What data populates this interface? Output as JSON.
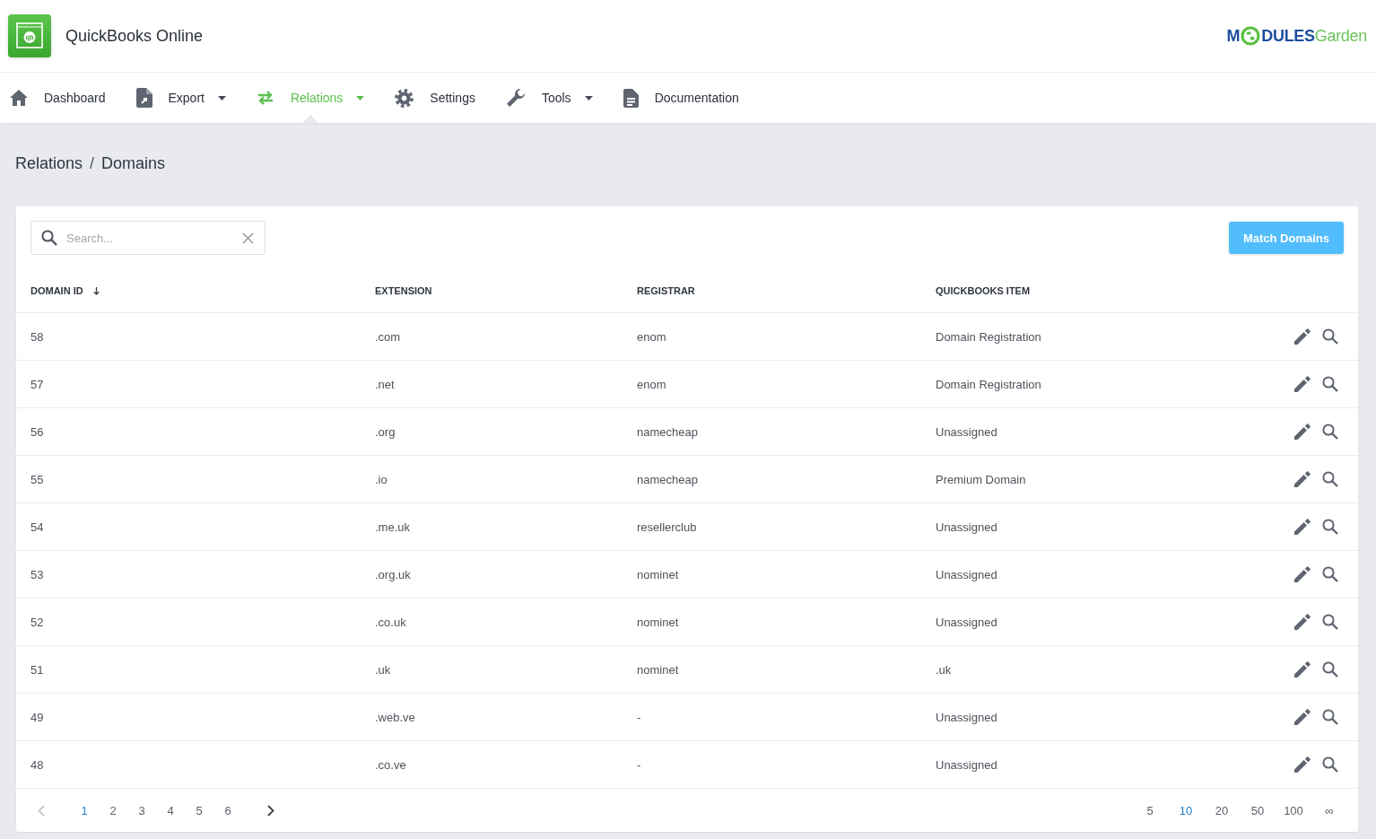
{
  "app": {
    "logo_text": "qb",
    "title": "QuickBooks Online"
  },
  "brand_logo": {
    "lead": "M",
    "rest": "**DULES**Garden"
  },
  "nav": [
    {
      "label": "Dashboard",
      "selected": false,
      "dropdown": false
    },
    {
      "label": "Export",
      "selected": false,
      "dropdown": true
    },
    {
      "label": "Relations",
      "selected": true,
      "dropdown": true
    },
    {
      "label": "Settings",
      "selected": false,
      "dropdown": false
    },
    {
      "label": "Tools",
      "selected": false,
      "dropdown": true
    },
    {
      "label": "Documentation",
      "selected": false,
      "dropdown": false
    }
  ],
  "breadcrumb": {
    "items": [
      "Relations",
      "Domains"
    ],
    "separator": "/"
  },
  "search": {
    "placeholder": "Search..."
  },
  "primary_button": "Match Domains",
  "table": {
    "columns": [
      {
        "label": "DOMAIN ID",
        "sorted": true
      },
      {
        "label": "EXTENSION",
        "sorted": false
      },
      {
        "label": "REGISTRAR",
        "sorted": false
      },
      {
        "label": "QUICKBOOKS ITEM",
        "sorted": false
      }
    ],
    "rows": [
      [
        "58",
        ".com",
        "enom",
        "Domain Registration"
      ],
      [
        "57",
        ".net",
        "enom",
        "Domain Registration"
      ],
      [
        "56",
        ".org",
        "namecheap",
        "Unassigned"
      ],
      [
        "55",
        ".io",
        "namecheap",
        "Premium Domain"
      ],
      [
        "54",
        ".me.uk",
        "resellerclub",
        "Unassigned"
      ],
      [
        "53",
        ".org.uk",
        "nominet",
        "Unassigned"
      ],
      [
        "52",
        ".co.uk",
        "nominet",
        "Unassigned"
      ],
      [
        "51",
        ".uk",
        "nominet",
        ".uk"
      ],
      [
        "49",
        ".web.ve",
        "-",
        "Unassigned"
      ],
      [
        "48",
        ".co.ve",
        "-",
        "Unassigned"
      ]
    ]
  },
  "pagination": {
    "previous": {
      "disabled": true
    },
    "pages": [
      {
        "label": "1",
        "selected": true
      },
      {
        "label": "2",
        "selected": false
      },
      {
        "label": "3",
        "selected": false
      },
      {
        "label": "4",
        "selected": false
      },
      {
        "label": "5",
        "selected": false
      },
      {
        "label": "6",
        "selected": false
      }
    ],
    "next": {
      "disabled": false
    },
    "page_sizes": [
      {
        "label": "5",
        "selected": false
      },
      {
        "label": "10",
        "selected": true
      },
      {
        "label": "20",
        "selected": false
      },
      {
        "label": "50",
        "selected": false
      },
      {
        "label": "100",
        "selected": false
      },
      {
        "label": "∞",
        "selected": false
      }
    ]
  }
}
